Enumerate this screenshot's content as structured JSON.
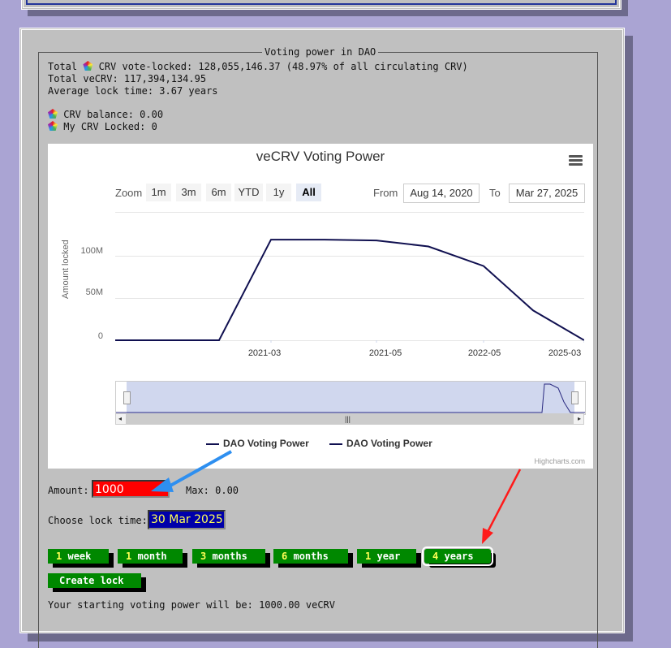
{
  "dao": {
    "legend": "Voting power in DAO",
    "total_locked_prefix": "Total",
    "total_locked_text": "CRV vote-locked: 128,055,146.37 (48.97% of all circulating CRV)",
    "total_vecrv": "Total veCRV: 117,394,134.95",
    "avg_lock": "Average lock time: 3.67 years",
    "crv_balance": "CRV balance: 0.00",
    "my_locked": "My CRV Locked: 0",
    "icon": "crv-token-icon"
  },
  "chart": {
    "title": "veCRV Voting Power",
    "zoom_label": "Zoom",
    "zoom_buttons": [
      "1m",
      "3m",
      "6m",
      "YTD",
      "1y",
      "All"
    ],
    "active_zoom": "All",
    "from_label": "From",
    "from_value": "Aug 14, 2020",
    "to_label": "To",
    "to_value": "Mar 27, 2025",
    "ylabel": "Amount locked",
    "yticks": [
      "100M",
      "50M",
      "0"
    ],
    "xticks": [
      "2021-03",
      "2021-05",
      "2022-05",
      "2025-03"
    ],
    "legend": [
      "DAO Voting Power",
      "DAO Voting Power"
    ],
    "credits": "Highcharts.com",
    "line_color": "#101050"
  },
  "chart_data": {
    "type": "line",
    "title": "veCRV Voting Power",
    "ylabel": "Amount locked",
    "ylim": [
      0,
      120
    ],
    "y_unit": "M",
    "x": [
      "2020-08",
      "2020-12",
      "2021-03",
      "2021-04",
      "2021-05",
      "2021-06",
      "2022-05",
      "2023-09",
      "2025-03"
    ],
    "series": [
      {
        "name": "DAO Voting Power",
        "values": [
          0,
          0,
          118,
          118,
          117,
          110,
          87,
          35,
          0
        ]
      }
    ]
  },
  "form": {
    "amount_label": "Amount:",
    "amount_value": "1000",
    "max_label": "Max: 0.00",
    "lock_time_label": "Choose lock time:",
    "lock_date": "30 Mar 2025",
    "lock_buttons": [
      {
        "num": "1",
        "unit": "week"
      },
      {
        "num": "1",
        "unit": "month"
      },
      {
        "num": "3",
        "unit": "months"
      },
      {
        "num": "6",
        "unit": "months"
      },
      {
        "num": "1",
        "unit": "year"
      },
      {
        "num": "4",
        "unit": "years"
      }
    ],
    "selected_lock": "4 years",
    "create_lock": "Create lock",
    "starting_power": "Your starting voting power will be: 1000.00 veCRV"
  },
  "annotations": {
    "blue_arrow_color": "#2e8ff0",
    "red_arrow_color": "#ff1a1a"
  }
}
